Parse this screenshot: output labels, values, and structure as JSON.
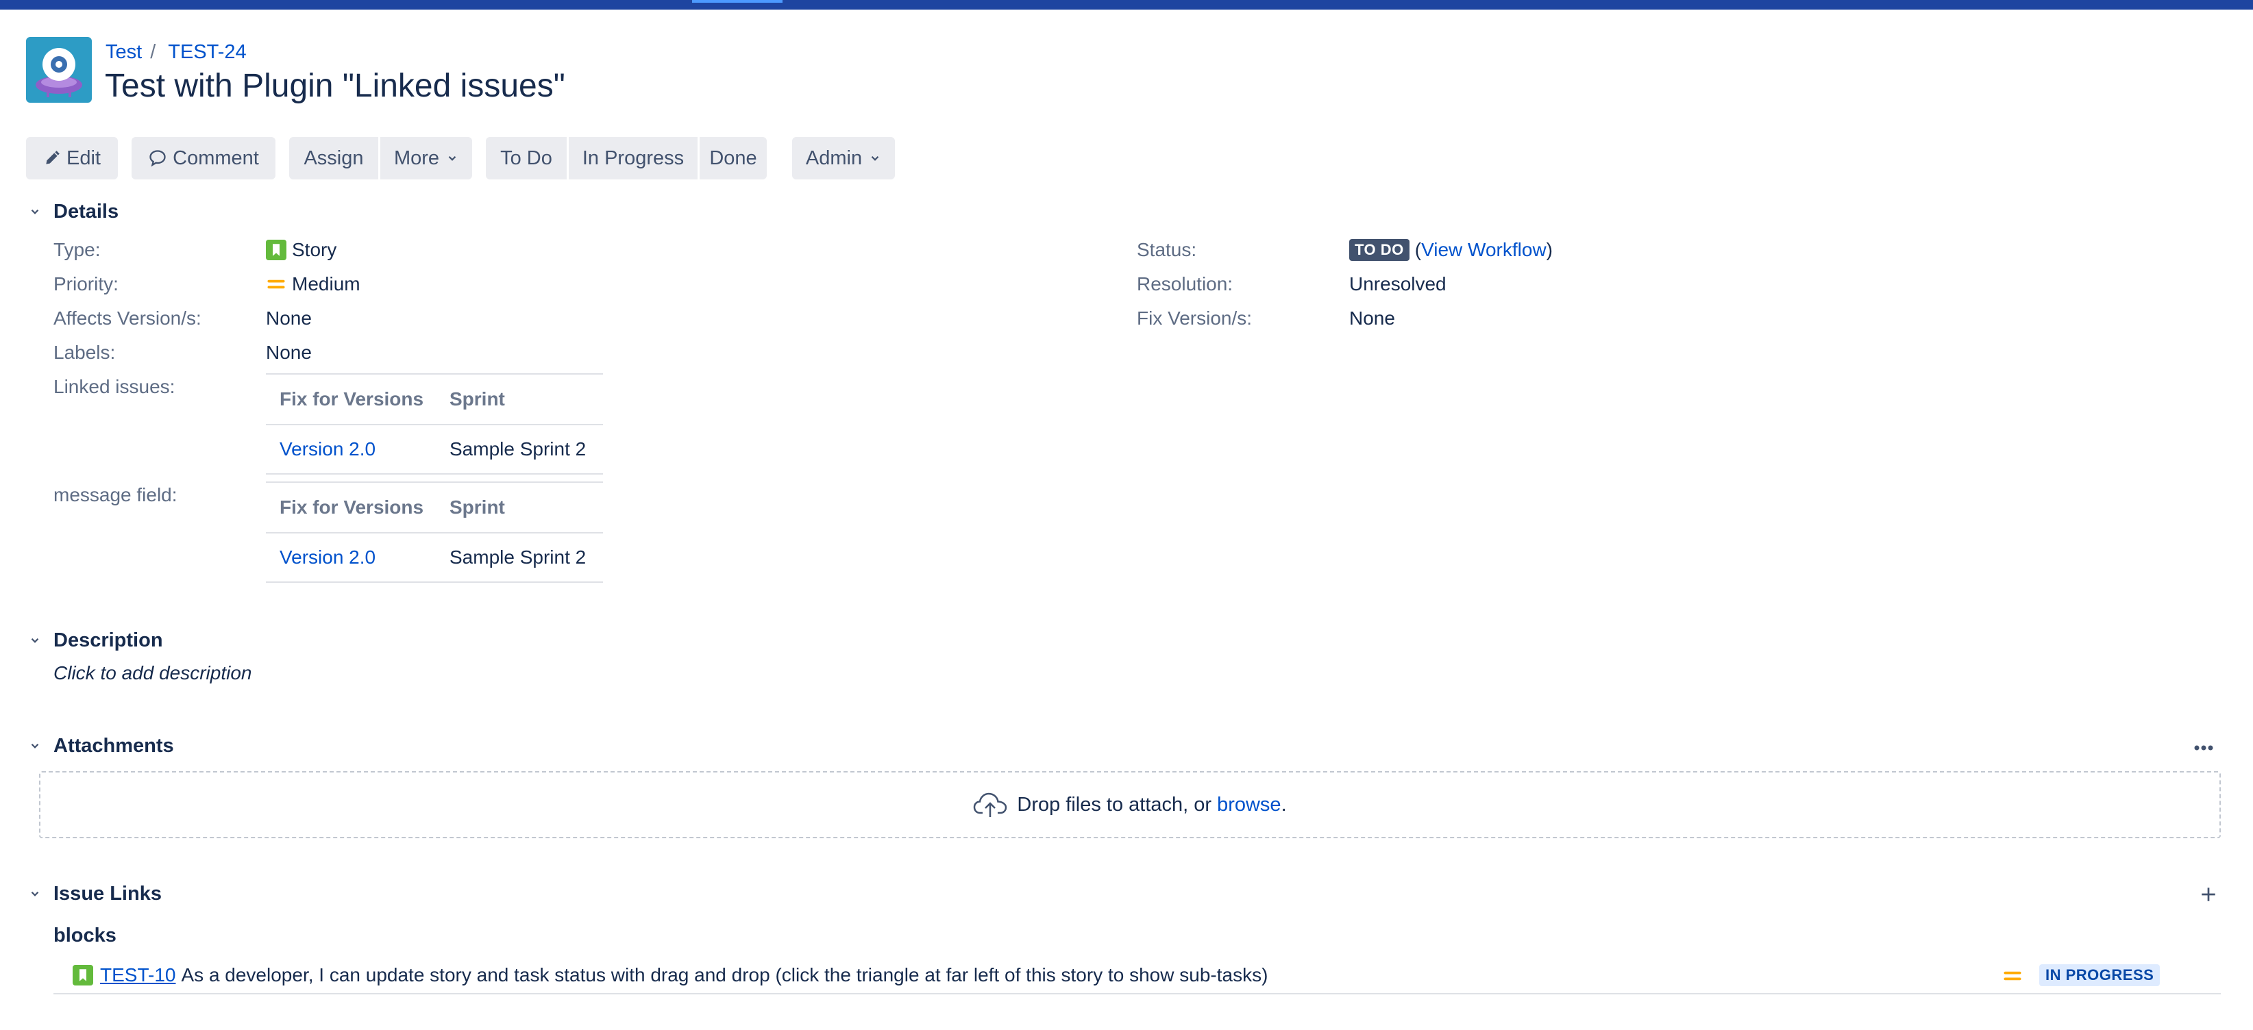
{
  "breadcrumb": {
    "project": "Test",
    "separator": "/",
    "issue_key": "TEST-24"
  },
  "issue": {
    "title": "Test with Plugin \"Linked issues\""
  },
  "toolbar": {
    "edit": "Edit",
    "comment": "Comment",
    "assign": "Assign",
    "more": "More",
    "todo": "To Do",
    "in_progress": "In Progress",
    "done": "Done",
    "admin": "Admin"
  },
  "details": {
    "heading": "Details",
    "type_label": "Type:",
    "type_value": "Story",
    "priority_label": "Priority:",
    "priority_value": "Medium",
    "affects_label": "Affects Version/s:",
    "affects_value": "None",
    "labels_label": "Labels:",
    "labels_value": "None",
    "linked_label": "Linked issues:",
    "message_label": "message field:",
    "status_label": "Status:",
    "status_value": "TO DO",
    "status_open_paren": "(",
    "status_link": "View Workflow",
    "status_close_paren": ")",
    "resolution_label": "Resolution:",
    "resolution_value": "Unresolved",
    "fix_label": "Fix Version/s:",
    "fix_value": "None"
  },
  "linked_table": {
    "headers": [
      "Fix for Versions",
      "Sprint"
    ],
    "rows": [
      [
        "Version 2.0",
        "Sample Sprint 2"
      ]
    ]
  },
  "message_table": {
    "headers": [
      "Fix for Versions",
      "Sprint"
    ],
    "rows": [
      [
        "Version 2.0",
        "Sample Sprint 2"
      ]
    ]
  },
  "description": {
    "heading": "Description",
    "placeholder": "Click to add description"
  },
  "attachments": {
    "heading": "Attachments",
    "drop_text": "Drop files to attach, or ",
    "browse": "browse",
    "period": "."
  },
  "issue_links": {
    "heading": "Issue Links",
    "type": "blocks",
    "items": [
      {
        "key": "TEST-10",
        "summary": "As a developer, I can update story and task status with drag and drop (click the triangle at far left of this story to show sub-tasks)",
        "status": "IN PROGRESS"
      }
    ]
  },
  "colors": {
    "brand_blue": "#0052cc",
    "top_bar": "#1e45a0",
    "story_green": "#63ba3c",
    "priority_medium": "#ffab00",
    "todo_lozenge": "#42526e",
    "inprogress_lozenge_bg": "#deebff"
  },
  "icons": {
    "project": "project-avatar-icon",
    "edit": "pencil-icon",
    "comment": "speech-bubble-icon",
    "chevron": "chevron-down-icon",
    "story": "story-icon",
    "priority": "priority-medium-icon",
    "upload": "cloud-upload-icon",
    "more": "more-dots-icon",
    "add": "plus-icon"
  }
}
